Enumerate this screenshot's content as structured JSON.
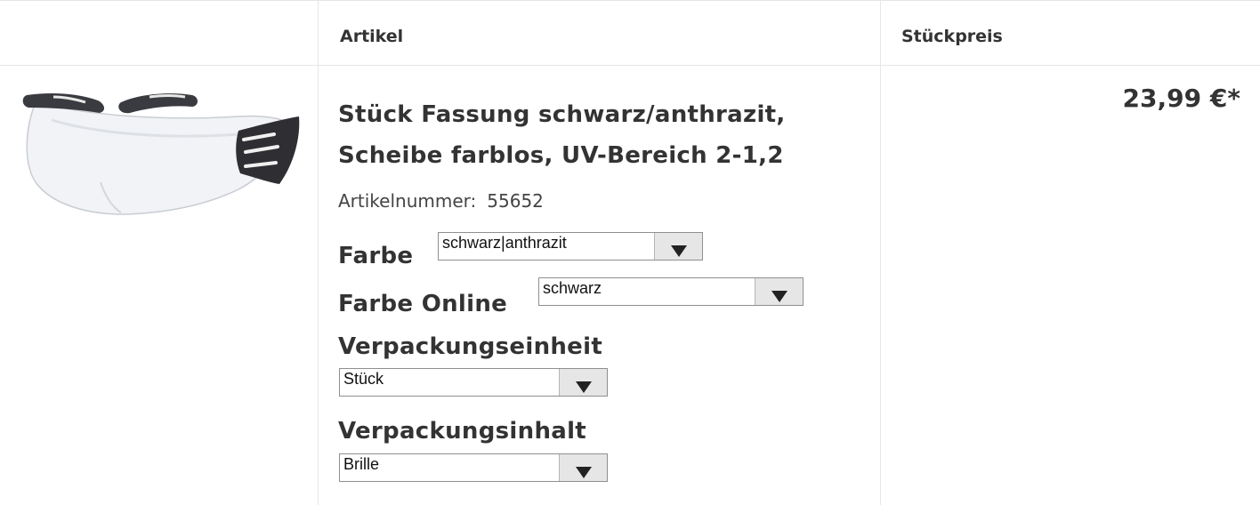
{
  "table": {
    "headers": {
      "image": "",
      "article": "Artikel",
      "unit_price": "Stückpreis"
    }
  },
  "product": {
    "title_line1": "Stück Fassung schwarz/anthrazit,",
    "title_line2": "Scheibe farblos, UV-Bereich 2-1,2",
    "sku_label": "Artikelnummer:",
    "sku_value": "55652",
    "price": "23,99 €*",
    "options": [
      {
        "label": "Farbe",
        "selected": "schwarz|anthrazit"
      },
      {
        "label": "Farbe Online",
        "selected": "schwarz"
      },
      {
        "label": "Verpackungseinheit",
        "selected": "Stück"
      },
      {
        "label": "Verpackungsinhalt",
        "selected": "Brille"
      }
    ]
  },
  "icons": {
    "dropdown": "chevron-down-icon"
  },
  "colors": {
    "text": "#333333",
    "border": "#e6e6e6",
    "select_button": "#e6e6e6",
    "frame": "#2e2e33"
  }
}
